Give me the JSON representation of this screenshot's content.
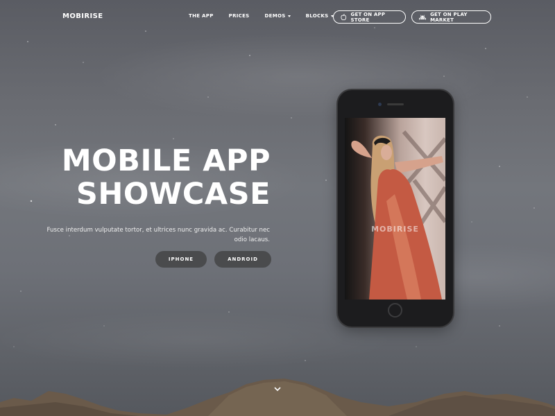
{
  "nav": {
    "brand": "MOBIRISE",
    "items": [
      {
        "label": "THE APP",
        "has_caret": false
      },
      {
        "label": "PRICES",
        "has_caret": false
      },
      {
        "label": "DEMOS",
        "has_caret": true
      },
      {
        "label": "BLOCKS",
        "has_caret": true
      }
    ],
    "app_store_label": "GET ON APP STORE",
    "play_market_label": "GET ON PLAY MARKET"
  },
  "hero": {
    "title_line1": "MOBILE APP",
    "title_line2": "SHOWCASE",
    "text": "Fusce interdum vulputate tortor, et ultrices nunc gravida ac. Curabitur nec odio lacaus.",
    "iphone_label": "IPHONE",
    "android_label": "ANDROID"
  },
  "phone": {
    "screen_brand": "MOBIRISE"
  },
  "icons": {
    "apple": "apple-icon",
    "play": "android-icon",
    "scroll": "chevron-down-icon"
  },
  "colors": {
    "hero_button_bg": "#4a4b4d",
    "text": "#ffffff"
  }
}
